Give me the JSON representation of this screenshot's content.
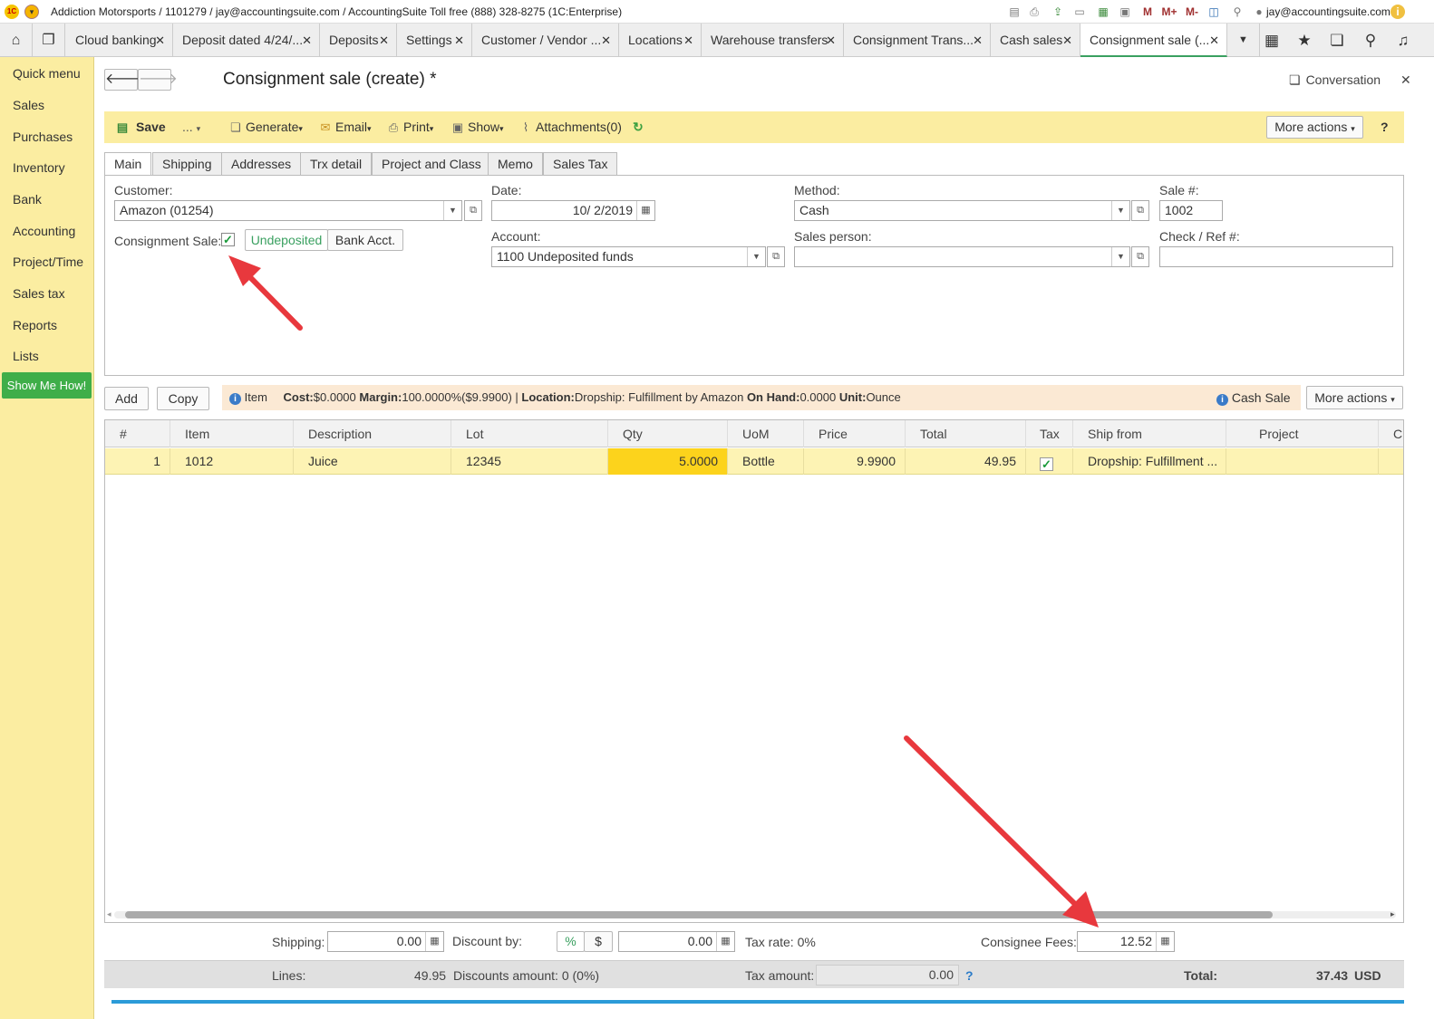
{
  "titlebar": {
    "text": "Addiction Motorsports / 1101279 / jay@accountingsuite.com / AccountingSuite Toll free (888) 328-8275   (1C:Enterprise)",
    "user": "jay@accountingsuite.com",
    "memory_labels": [
      "M",
      "M+",
      "M-"
    ]
  },
  "tabs": [
    {
      "label": "Cloud banking"
    },
    {
      "label": "Deposit dated 4/24/..."
    },
    {
      "label": "Deposits"
    },
    {
      "label": "Settings"
    },
    {
      "label": "Customer / Vendor ..."
    },
    {
      "label": "Locations"
    },
    {
      "label": "Warehouse transfers"
    },
    {
      "label": "Consignment Trans..."
    },
    {
      "label": "Cash sales"
    },
    {
      "label": "Consignment sale (..."
    }
  ],
  "sidebar": {
    "items": [
      "Quick menu",
      "Sales",
      "Purchases",
      "Inventory",
      "Bank",
      "Accounting",
      "Project/Time",
      "Sales tax",
      "Reports",
      "Lists"
    ],
    "show_me": "Show Me How!"
  },
  "form": {
    "title": "Consignment sale (create) *",
    "conversation": "Conversation"
  },
  "toolbar": {
    "save": "Save",
    "more": "...",
    "generate": "Generate",
    "email": "Email",
    "print": "Print",
    "show": "Show",
    "attachments": "Attachments(0)",
    "more_actions": "More actions",
    "help": "?"
  },
  "form_tabs": [
    "Main",
    "Shipping",
    "Addresses",
    "Trx detail",
    "Project and Class",
    "Memo",
    "Sales Tax"
  ],
  "main": {
    "customer_label": "Customer:",
    "customer_value": "Amazon (01254)",
    "consignment_label": "Consignment Sale:",
    "undeposited": "Undeposited",
    "bank_acct": "Bank Acct.",
    "date_label": "Date:",
    "date_value": "10/ 2/2019",
    "account_label": "Account:",
    "account_value": "1100 Undeposited funds",
    "method_label": "Method:",
    "method_value": "Cash",
    "sales_person_label": "Sales person:",
    "sales_person_value": "",
    "sale_no_label": "Sale #:",
    "sale_no_value": "1002",
    "check_label": "Check / Ref #:",
    "check_value": ""
  },
  "lines_bar": {
    "add": "Add",
    "copy": "Copy",
    "item_label": "Item",
    "cost_label": "Cost:",
    "cost_value": "$0.0000",
    "margin_label": "Margin:",
    "margin_value": "100.0000%($9.9900) |",
    "location_label": "Location:",
    "location_value": "Dropship: Fulfillment by Amazon",
    "onhand_label": "On Hand:",
    "onhand_value": "0.0000",
    "unit_label": "Unit:",
    "unit_value": "Ounce",
    "cash_sale": "Cash Sale",
    "more_actions": "More actions"
  },
  "grid": {
    "headers": [
      "#",
      "Item",
      "Description",
      "Lot",
      "Qty",
      "UoM",
      "Price",
      "Total",
      "Tax",
      "Ship from",
      "Project",
      "C"
    ],
    "rows": [
      {
        "no": "1",
        "item": "1012",
        "description": "Juice",
        "lot": "12345",
        "qty": "5.0000",
        "uom": "Bottle",
        "price": "9.9900",
        "total": "49.95",
        "tax": true,
        "ship_from": "Dropship: Fulfillment ...",
        "project": ""
      }
    ]
  },
  "totals": {
    "shipping_label": "Shipping:",
    "shipping_value": "0.00",
    "discount_label": "Discount by:",
    "pct": "%",
    "dollar": "$",
    "discount_value": "0.00",
    "tax_rate": "Tax rate: 0%",
    "consignee_label": "Consignee Fees:",
    "consignee_value": "12.52",
    "lines_label": "Lines:",
    "lines_value": "49.95",
    "discounts_amount": "Discounts amount:  0   (0%)",
    "tax_amount_label": "Tax amount:",
    "tax_amount_value": "0.00",
    "tax_help": "?",
    "total_label": "Total:",
    "total_value": "37.43",
    "currency": "USD"
  },
  "colors": {
    "sidebar": "#fbeda1",
    "accent_green": "#3fae49",
    "annotation_red": "#e8383d",
    "row_highlight": "#fdf3b4",
    "qty_highlight": "#fcd31c"
  }
}
